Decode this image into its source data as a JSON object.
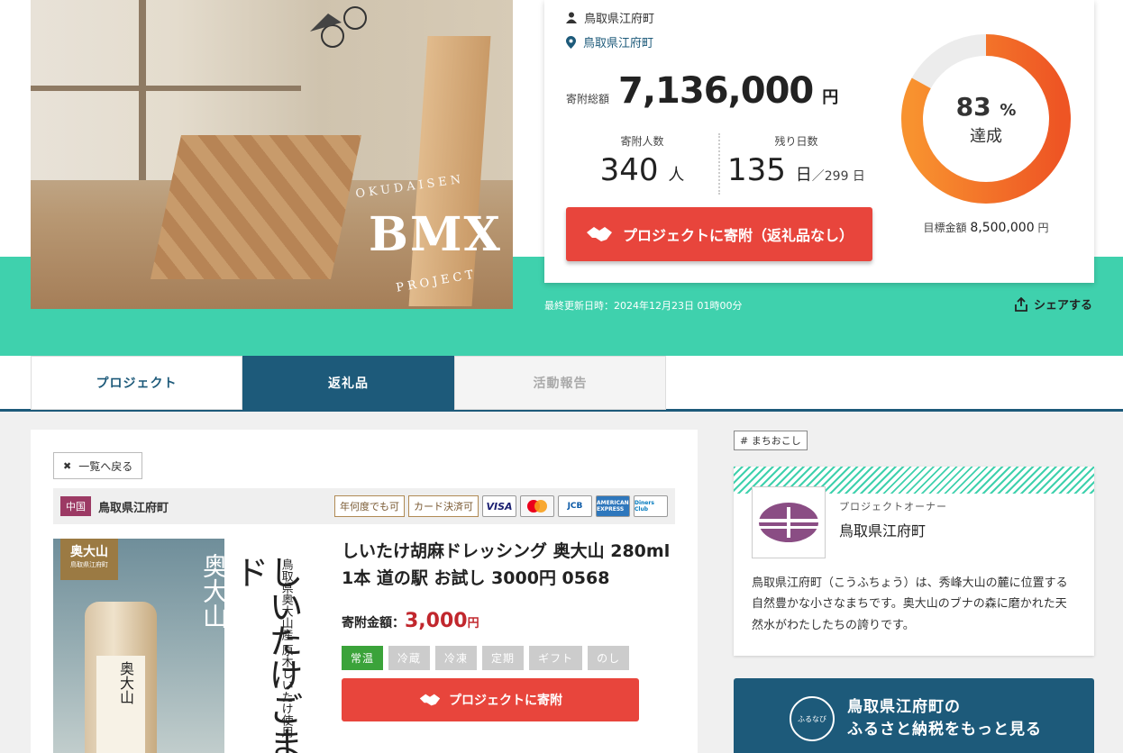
{
  "hero": {
    "image_logo": {
      "top": "OKUDAISEN",
      "main": "BMX",
      "bottom": "PROJECT"
    },
    "updated": "最終更新日時：2024年12月23日 01時00分",
    "share_label": "シェアする"
  },
  "stats": {
    "owner": "鳥取県江府町",
    "location": "鳥取県江府町",
    "total_label": "寄附総額",
    "total_amount": "7,136,000",
    "total_unit": "円",
    "donors_label": "寄附人数",
    "donors_value": "340",
    "donors_unit": "人",
    "days_label": "残り日数",
    "days_value": "135",
    "days_unit": "日",
    "days_total": "／299 日",
    "cta": "プロジェクトに寄附（返礼品なし）",
    "progress_percent": 83,
    "progress_pct_text": "83",
    "progress_pct_sign": "%",
    "progress_label": "達成",
    "goal_label": "目標金額",
    "goal_amount": "8,500,000",
    "goal_unit": "円",
    "accent_color": "#f4792a"
  },
  "tabs": [
    {
      "label": "プロジェクト"
    },
    {
      "label": "返礼品"
    },
    {
      "label": "活動報告"
    }
  ],
  "product": {
    "back_label": "一覧へ戻る",
    "region": "中国",
    "town": "鳥取県江府町",
    "badges": [
      "年何度でも可",
      "カード決済可"
    ],
    "card_icons": [
      "VISA",
      "MasterCard",
      "JCB",
      "AMERICAN EXPRESS",
      "Diners Club"
    ],
    "image_texts": {
      "label_main": "奥大山",
      "label_sub": "鳥取県江府町",
      "vertical_main": "しいたけごまド",
      "vertical_white": "奥大山",
      "vertical_small": "鳥取県奥大山産 原木しいたけ使用",
      "bottle_label": "奥大山"
    },
    "title": "しいたけ胡麻ドレッシング 奥大山 280ml 1本 道の駅 お試し 3000円 0568",
    "price_label": "寄附金額：",
    "price": "3,000",
    "price_unit": "円",
    "tags": [
      {
        "label": "常温",
        "active": true
      },
      {
        "label": "冷蔵",
        "active": false
      },
      {
        "label": "冷凍",
        "active": false
      },
      {
        "label": "定期",
        "active": false
      },
      {
        "label": "ギフト",
        "active": false
      },
      {
        "label": "のし",
        "active": false
      }
    ],
    "cta": "プロジェクトに寄附"
  },
  "sidebar": {
    "hashtag": "# まちおこし",
    "owner_sub": "プロジェクトオーナー",
    "owner_name": "鳥取県江府町",
    "owner_desc": "鳥取県江府町（こうふちょう）は、秀峰大山の麓に位置する自然豊かな小さなまちです。奥大山のブナの森に磨かれた天然水がわたしたちの誇りです。",
    "furusato_icon_text": "ふるなび",
    "furusato_line1": "鳥取県江府町の",
    "furusato_line2": "ふるさと納税をもっと見る"
  }
}
